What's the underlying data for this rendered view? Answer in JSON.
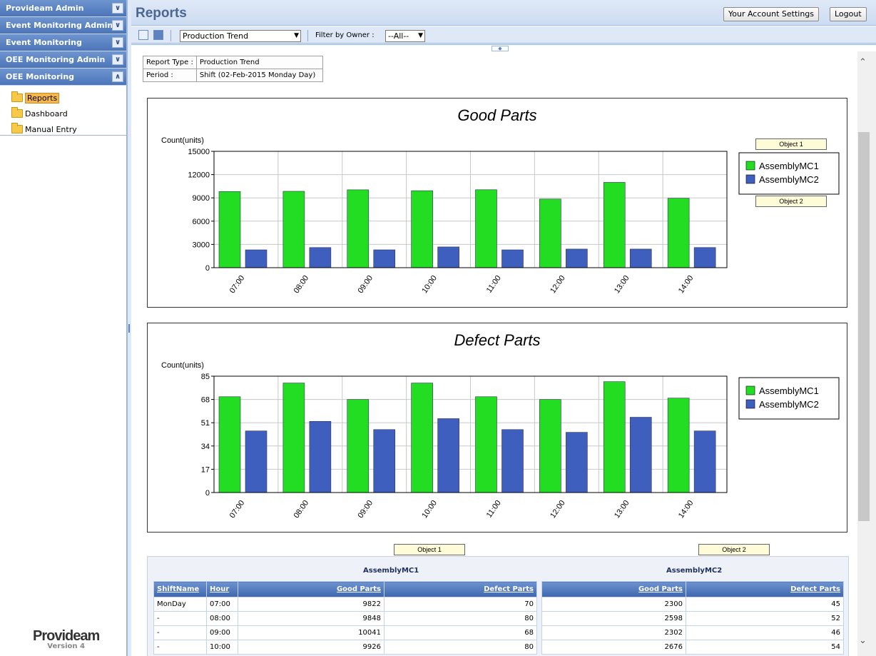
{
  "sidebar": {
    "sections": [
      {
        "label": "Provideam Admin"
      },
      {
        "label": "Event Monitoring Admin"
      },
      {
        "label": "Event Monitoring"
      },
      {
        "label": "OEE Monitoring Admin"
      },
      {
        "label": "OEE Monitoring"
      }
    ],
    "items": [
      {
        "label": "Reports"
      },
      {
        "label": "Dashboard"
      },
      {
        "label": "Manual Entry"
      }
    ],
    "logo": {
      "brand": "Provideam",
      "version": "Version 4"
    }
  },
  "header": {
    "title": "Reports",
    "account_settings_label": "Your Account Settings",
    "logout_label": "Logout"
  },
  "toolbar": {
    "report_select_value": "Production Trend",
    "filter_label": "Filter by Owner :",
    "owner_select_value": "--All--"
  },
  "report_info": {
    "type_label": "Report Type :",
    "type_value": "Production Trend",
    "period_label": "Period :",
    "period_value": "Shift (02-Feb-2015 Monday Day)"
  },
  "callouts": {
    "object1": "Object 1",
    "object2": "Object 2"
  },
  "chart_data": [
    {
      "type": "bar",
      "title": "Good Parts",
      "ylabel": "Count(units)",
      "xlabel": "",
      "categories": [
        "07:00",
        "08:00",
        "09:00",
        "10:00",
        "11:00",
        "12:00",
        "13:00",
        "14:00"
      ],
      "ylim": [
        0,
        15000
      ],
      "yticks": [
        "0",
        "3000",
        "6000",
        "9000",
        "12000",
        "15000"
      ],
      "grid": true,
      "legend_position": "right",
      "series": [
        {
          "name": "AssemblyMC1",
          "color": "#22dd22",
          "values": [
            9822,
            9848,
            10041,
            9926,
            10050,
            8850,
            11000,
            8950
          ]
        },
        {
          "name": "AssemblyMC2",
          "color": "#3f5fbf",
          "values": [
            2300,
            2598,
            2302,
            2676,
            2300,
            2400,
            2400,
            2600
          ]
        }
      ]
    },
    {
      "type": "bar",
      "title": "Defect Parts",
      "ylabel": "Count(units)",
      "xlabel": "",
      "categories": [
        "07:00",
        "08:00",
        "09:00",
        "10:00",
        "11:00",
        "12:00",
        "13:00",
        "14:00"
      ],
      "ylim": [
        0,
        85
      ],
      "yticks": [
        "0",
        "17",
        "34",
        "51",
        "68",
        "85"
      ],
      "grid": true,
      "legend_position": "right",
      "series": [
        {
          "name": "AssemblyMC1",
          "color": "#22dd22",
          "values": [
            70,
            80,
            68,
            80,
            70,
            68,
            81,
            69
          ]
        },
        {
          "name": "AssemblyMC2",
          "color": "#3f5fbf",
          "values": [
            45,
            52,
            46,
            54,
            46,
            44,
            55,
            45
          ]
        }
      ]
    }
  ],
  "data_table": {
    "group1_title": "AssemblyMC1",
    "group2_title": "AssemblyMC2",
    "headers": {
      "shift": "ShiftName",
      "hour": "Hour",
      "good": "Good Parts",
      "defect": "Defect Parts"
    },
    "rows": [
      {
        "shift": "MonDay",
        "hour": "07:00",
        "mc1_good": "9822",
        "mc1_defect": "70",
        "mc2_good": "2300",
        "mc2_defect": "45"
      },
      {
        "shift": "-",
        "hour": "08:00",
        "mc1_good": "9848",
        "mc1_defect": "80",
        "mc2_good": "2598",
        "mc2_defect": "52"
      },
      {
        "shift": "-",
        "hour": "09:00",
        "mc1_good": "10041",
        "mc1_defect": "68",
        "mc2_good": "2302",
        "mc2_defect": "46"
      },
      {
        "shift": "-",
        "hour": "10:00",
        "mc1_good": "9926",
        "mc1_defect": "80",
        "mc2_good": "2676",
        "mc2_defect": "54"
      }
    ]
  }
}
